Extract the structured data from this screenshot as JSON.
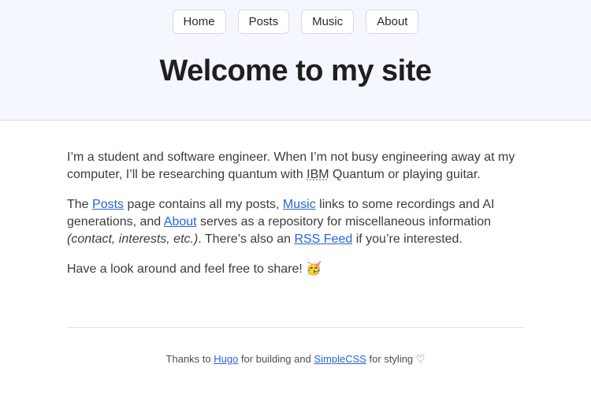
{
  "colors": {
    "header_bg": "#f5f7ff",
    "header_border": "#dcdee8",
    "button_border": "#d8dae1",
    "heading_text": "#1f1f1f",
    "body_text": "#3c3c3c",
    "link": "#2b63d9",
    "footer_text": "#4f4f4f"
  },
  "header": {
    "nav": [
      {
        "label": "Home"
      },
      {
        "label": "Posts"
      },
      {
        "label": "Music"
      },
      {
        "label": "About"
      }
    ],
    "title": "Welcome to my site"
  },
  "main": {
    "p1": {
      "text_1": "I’m a student and software engineer. When I’m not busy engineering away at my computer, I’ll be researching quantum with ",
      "abbr": "IBM",
      "text_2": " Quantum or playing guitar."
    },
    "p2": {
      "t1": "The ",
      "link_posts": "Posts",
      "t2": " page contains all my posts, ",
      "link_music": "Music",
      "t3": " links to some recordings and AI generations, and ",
      "link_about": "About",
      "t4": " serves as a repository for miscellaneous information ",
      "em": "(contact, interests, etc.)",
      "t5": ". There’s also an ",
      "link_rss": "RSS Feed",
      "t6": " if you’re interested."
    },
    "p3": {
      "text": "Have a look around and feel free to share! 🥳"
    }
  },
  "footer": {
    "t1": "Thanks to ",
    "link_hugo": "Hugo",
    "t2": " for building and ",
    "link_simplecss": "SimpleCSS",
    "t3": " for styling ♡"
  }
}
